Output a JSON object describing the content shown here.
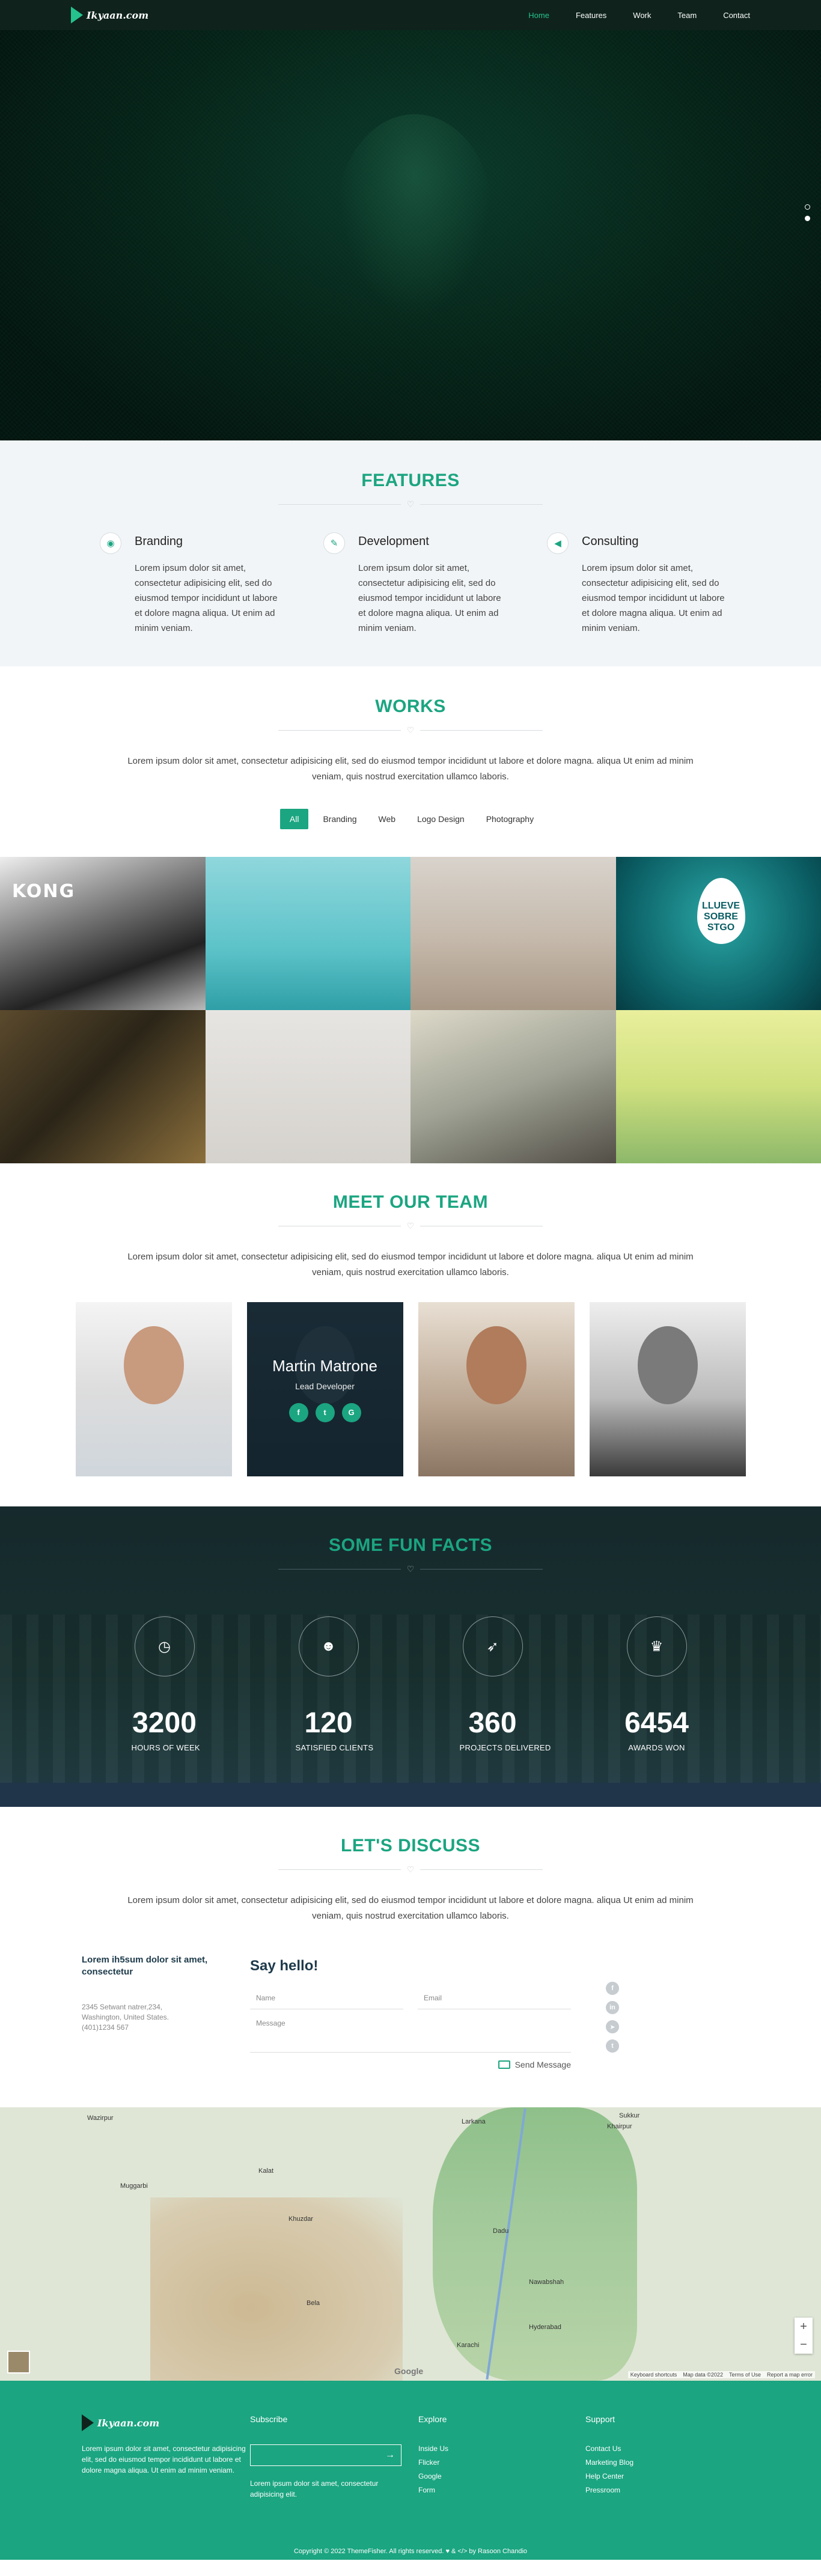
{
  "nav": {
    "logo": "Ikyaan.com",
    "links": [
      {
        "label": "Home",
        "active": true
      },
      {
        "label": "Features",
        "active": false
      },
      {
        "label": "Work",
        "active": false
      },
      {
        "label": "Team",
        "active": false
      },
      {
        "label": "Contact",
        "active": false
      }
    ]
  },
  "features": {
    "title": "FEATURES",
    "items": [
      {
        "icon": "github-icon",
        "title": "Branding",
        "text": "Lorem ipsum dolor sit amet, consectetur adipisicing elit, sed do eiusmod tempor incididunt ut labore et dolore magna aliqua. Ut enim ad minim veniam."
      },
      {
        "icon": "pencil-icon",
        "title": "Development",
        "text": "Lorem ipsum dolor sit amet, consectetur adipisicing elit, sed do eiusmod tempor incididunt ut labore et dolore magna aliqua. Ut enim ad minim veniam."
      },
      {
        "icon": "megaphone-icon",
        "title": "Consulting",
        "text": "Lorem ipsum dolor sit amet, consectetur adipisicing elit, sed do eiusmod tempor incididunt ut labore et dolore magna aliqua. Ut enim ad minim veniam."
      }
    ]
  },
  "works": {
    "title": "WORKS",
    "lead": "Lorem ipsum dolor sit amet, consectetur adipisicing elit, sed do eiusmod tempor incididunt ut labore et dolore magna. aliqua Ut enim ad minim veniam, quis nostrud exercitation ullamco laboris.",
    "filters": [
      "All",
      "Branding",
      "Web",
      "Logo Design",
      "Photography"
    ],
    "tile_texts": {
      "kong": "KONG",
      "drop": "LLUEVE SOBRE STGO"
    }
  },
  "team": {
    "title": "MEET OUR TEAM",
    "lead": "Lorem ipsum dolor sit amet, consectetur adipisicing elit, sed do eiusmod tempor incididunt ut labore et dolore magna. aliqua Ut enim ad minim veniam, quis nostrud exercitation ullamco laboris.",
    "featured_name": "Martin Matrone",
    "featured_role": "Lead Developer",
    "socials": [
      "f",
      "t",
      "G"
    ]
  },
  "facts": {
    "title": "SOME FUN FACTS",
    "items": [
      {
        "icon": "clock-icon",
        "value": "3200",
        "label": "HOURS OF WEEK"
      },
      {
        "icon": "users-icon",
        "value": "120",
        "label": "SATISFIED CLIENTS"
      },
      {
        "icon": "rocket-icon",
        "value": "360",
        "label": "PROJECTS DELIVERED"
      },
      {
        "icon": "trophy-icon",
        "value": "6454",
        "label": "AWARDS WON"
      }
    ]
  },
  "contact": {
    "title": "LET'S DISCUSS",
    "lead": "Lorem ipsum dolor sit amet, consectetur adipisicing elit, sed do eiusmod tempor incididunt ut labore et dolore magna. aliqua Ut enim ad minim veniam, quis nostrud exercitation ullamco laboris.",
    "address_heading": "Lorem ih5sum dolor sit amet, consectetur",
    "address_line1": "2345 Setwant natrer,234,",
    "address_line2": "Washington, United States.",
    "address_line3": "(401)1234 567",
    "say_hello": "Say hello!",
    "name_placeholder": "Name",
    "email_placeholder": "Email",
    "message_placeholder": "Message",
    "send_label": "Send Message"
  },
  "map": {
    "towns": [
      "Wazirpur",
      "Larkana",
      "Khairpur",
      "Muggarbi",
      "Kalat",
      "Khuzdar",
      "Nawabshah",
      "Karachi",
      "Hyderabad",
      "Bela",
      "Dadu",
      "Sukkur"
    ],
    "footer": [
      "Keyboard shortcuts",
      "Map data ©2022",
      "Terms of Use",
      "Report a map error"
    ],
    "google": "Google"
  },
  "footer": {
    "logo": "Ikyaan.com",
    "about": "Lorem ipsum dolor sit amet, consectetur adipisicing elit, sed do eiusmod tempor incididunt ut labore et dolore magna aliqua. Ut enim ad minim veniam.",
    "subscribe_title": "Subscribe",
    "subscribe_text": "Lorem ipsum dolor sit amet, consectetur adipisicing elit.",
    "explore_title": "Explore",
    "explore_links": [
      "Inside Us",
      "Flicker",
      "Google",
      "Form"
    ],
    "support_title": "Support",
    "support_links": [
      "Contact Us",
      "Marketing Blog",
      "Help Center",
      "Pressroom"
    ],
    "copyright": "Copyright © 2022 ThemeFisher. All rights reserved. ♥ & </> by Rasoon Chandio"
  }
}
